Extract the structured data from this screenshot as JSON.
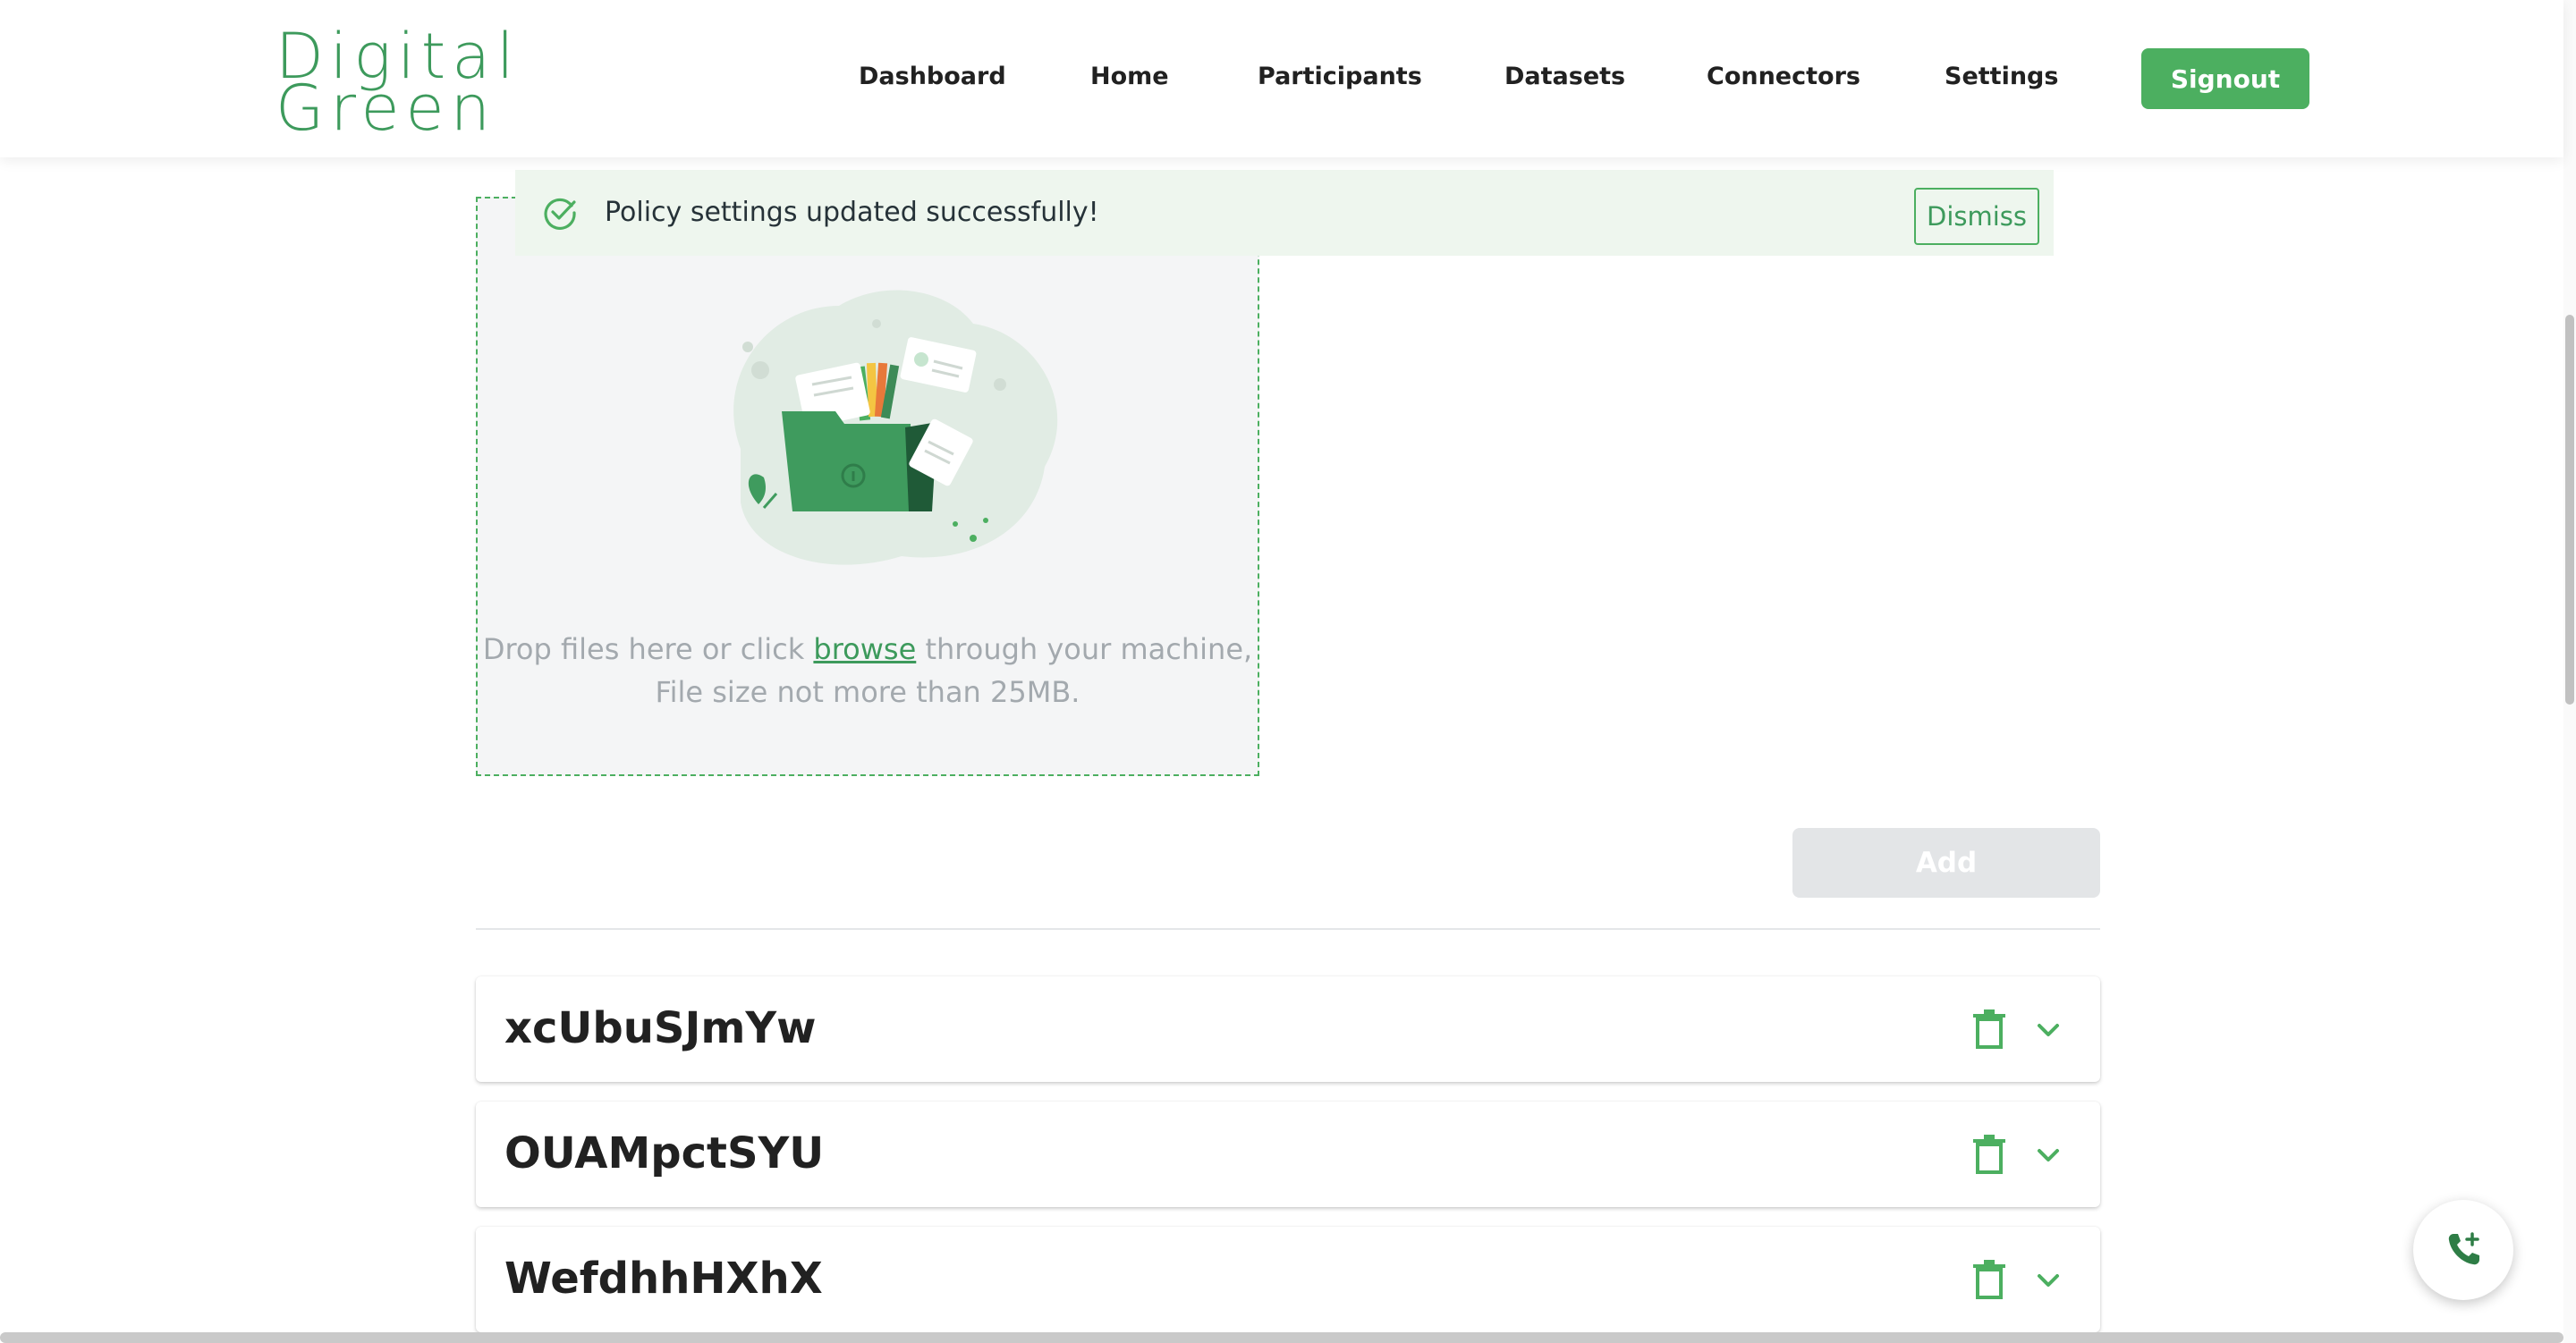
{
  "header": {
    "logo_line1": "Digital",
    "logo_line2": "Green",
    "nav": [
      {
        "label": "Dashboard"
      },
      {
        "label": "Home"
      },
      {
        "label": "Participants"
      },
      {
        "label": "Datasets"
      },
      {
        "label": "Connectors"
      },
      {
        "label": "Settings"
      }
    ],
    "signout_label": "Signout"
  },
  "alert": {
    "message": "Policy settings updated successfully!",
    "dismiss_label": "Dismiss"
  },
  "dropzone": {
    "text_before": "Drop files here or click ",
    "browse_label": "browse",
    "text_after": " through your machine, File size not more than 25MB."
  },
  "add_label": "Add",
  "policies": [
    {
      "name": "xcUbuSJmYw"
    },
    {
      "name": "OUAMpctSYU"
    },
    {
      "name": "WefdhhHXhX"
    }
  ],
  "colors": {
    "brand_green": "#4caf60",
    "logo_green": "#3d9a5c",
    "alert_bg": "#eef6ee",
    "disabled_button": "#e3e5e7"
  },
  "icons": {
    "alert": "check-circle-icon",
    "delete": "trash-icon",
    "expand": "chevron-down-icon",
    "fab": "phone-add-icon"
  }
}
